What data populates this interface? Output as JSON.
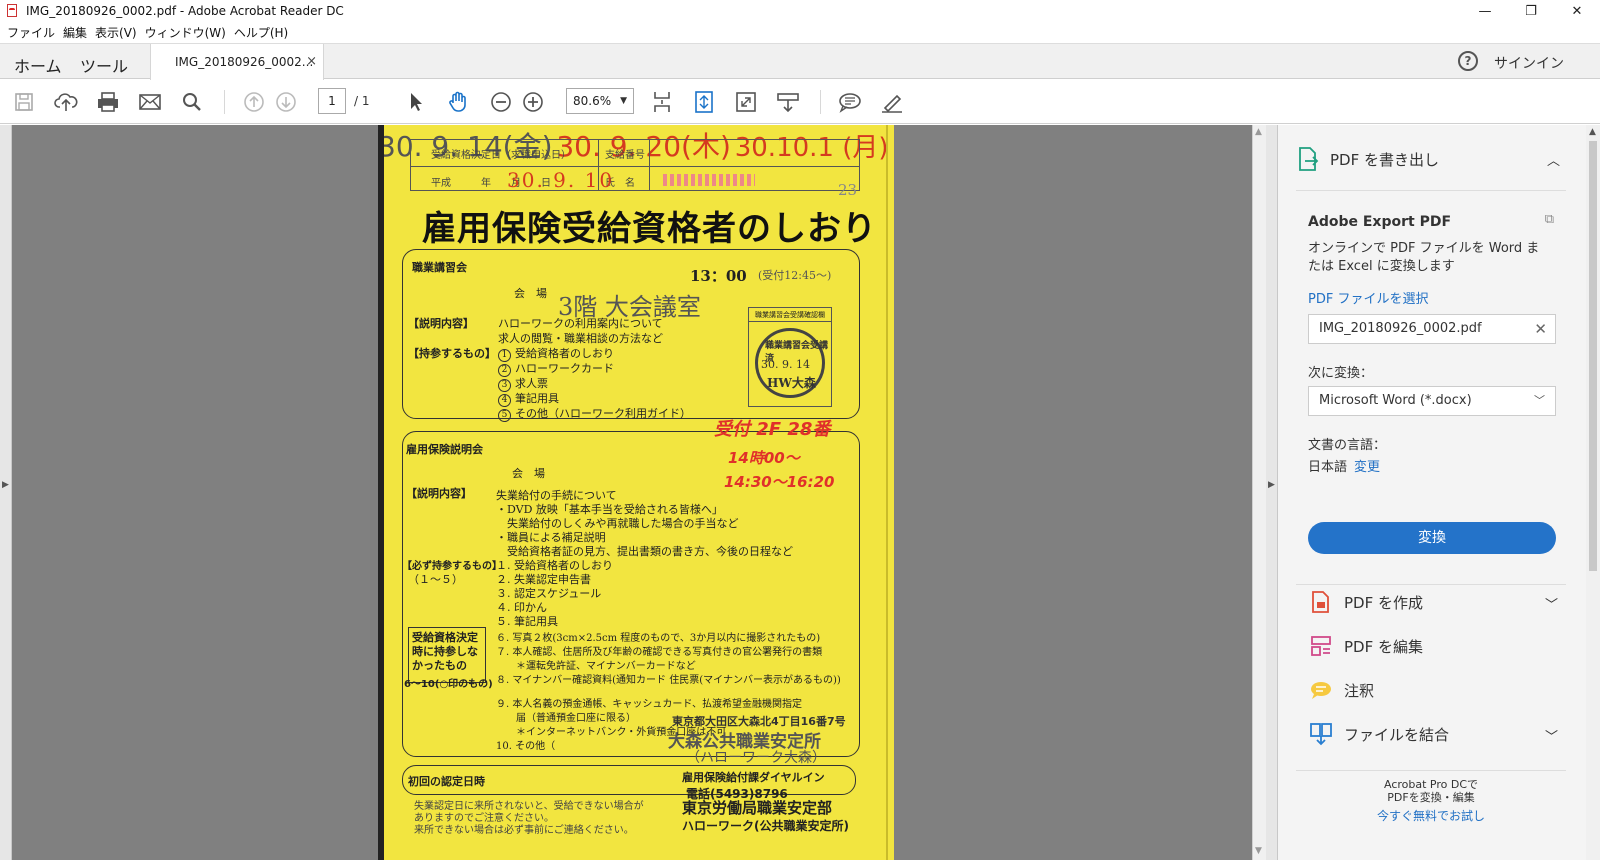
{
  "window": {
    "title": "IMG_20180926_0002.pdf - Adobe Acrobat Reader DC",
    "min": "—",
    "restore": "❐",
    "close": "✕"
  },
  "menu": [
    "ファイル",
    "編集",
    "表示(V)",
    "ウィンドウ(W)",
    "ヘルプ(H)"
  ],
  "tabs": {
    "home": "ホーム",
    "tools": "ツール",
    "doc": "IMG_20180926_0002...",
    "close": "×",
    "help": "?",
    "signin": "サインイン"
  },
  "toolbar": {
    "page_current": "1",
    "page_total": "/ 1",
    "zoom": "80.6%"
  },
  "document": {
    "hdr_label1": "受給資格決定日（求職申込日）",
    "hdr_label2": "平成　　　年　　月　　日",
    "hdr_date": "30. 9. 10",
    "hdr_label3": "支給番号",
    "hdr_label4": "氏　名",
    "page_mark": "23",
    "title": "雇用保険受給資格者のしおり",
    "s1_label": "職業講習会",
    "s1_date": "30. 9. 14(金)",
    "s1_time": "13：00",
    "s1_reception": "(受付12:45〜)",
    "s1_venue_label": "会　場",
    "s1_venue": "3階 大会議室",
    "s1_content_label": "【説明内容】",
    "s1_content1": "ハローワークの利用案内について",
    "s1_content2": "求人の閲覧・職業相談の方法など",
    "s1_bring_label": "【持参するもの】",
    "s1_items": [
      "受給資格者のしおり",
      "ハローワークカード",
      "求人票",
      "筆記用具",
      "その他（ハローワーク利用ガイド）"
    ],
    "stamp_head": "職業講習会受講確認欄",
    "stamp_l1": "職業講習会受講済",
    "stamp_l2": "30. 9. 14",
    "stamp_l3": "HW大森",
    "s2_label": "雇用保険説明会",
    "s2_date": "30. 9. 20(木)",
    "s2_hand1": "受付 2F 28番",
    "s2_hand2": "14時00〜",
    "s2_hand3": "14:30〜16:20",
    "s2_venue_label": "会　場",
    "s2_content_label": "【説明内容】",
    "s2_content": [
      "失業給付の手続について",
      "・DVD 放映「基本手当を受給される皆様へ」",
      "　失業給付のしくみや再就職した場合の手当など",
      "・職員による補足説明",
      "　受給資格者証の見方、提出書類の書き方、今後の日程など"
    ],
    "s2_bring_label": "【必ず持参するもの】",
    "s2_bring_range": "（１〜５）",
    "s2_items": [
      "１. 受給資格者のしおり",
      "２. 失業認定申告書",
      "３. 認定スケジュール",
      "４. 印かん",
      "５. 筆記用具",
      "６. 写真２枚(3cm×2.5cm 程度のもので、3か月以内に撮影されたもの)",
      "７. 本人確認、住居所及び年齢の確認できる写真付きの官公署発行の書類",
      "　　＊運転免許証、マイナンバーカードなど",
      "８. マイナンバー確認資料(通知カード 住民票(マイナンバー表示があるもの))",
      "９. 本人名義の預金通帳、キャッシュカード、払渡希望金融機関指定",
      "　　届（普通預金口座に限る）",
      "　　＊インターネットバンク・外貨預金口座は不可",
      "10. その他（"
    ],
    "s2_box": "受給資格決定時に持参しなかったもの",
    "s2_box_note": "6〜10(○印のもの)",
    "office1": "東京都大田区大森北4丁目16番7号",
    "office2": "大森公共職業安定所",
    "office3": "（ハローワーク大森）",
    "office4": "雇用保険給付課ダイヤルイン",
    "office5": "電話(5493)8796",
    "s3_label": "初回の認定日時",
    "s3_date": "30.10.1 (月)",
    "footer1": "失業認定日に来所されないと、受給できない場合が",
    "footer2": "ありますのでご注意ください。",
    "footer3": "来所できない場合は必ず事前にご連絡ください。",
    "issuer1": "東京労働局職業安定部",
    "issuer2": "ハローワーク(公共職業安定所)"
  },
  "right_pane": {
    "export_head": "PDF を書き出し",
    "card_title": "Adobe Export PDF",
    "card_desc": "オンラインで PDF ファイルを Word または Excel に変換します",
    "select_link": "PDF ファイルを選択",
    "file_name": "IMG_20180926_0002.pdf",
    "convert_to_label": "次に変換：",
    "convert_to_value": "Microsoft Word (*.docx)",
    "lang_label": "文書の言語：",
    "lang_value": "日本語",
    "lang_change": "変更",
    "convert_button": "変換",
    "items": [
      "PDF を作成",
      "PDF を編集",
      "注釈",
      "ファイルを結合"
    ],
    "promo1": "Acrobat Pro DCで",
    "promo2": "PDFを変換・編集",
    "promo_link": "今すぐ無料でお試し"
  },
  "colors": {
    "accent": "#2473c9",
    "page_bg": "#f2e540",
    "handwriting": "#e0302a"
  }
}
